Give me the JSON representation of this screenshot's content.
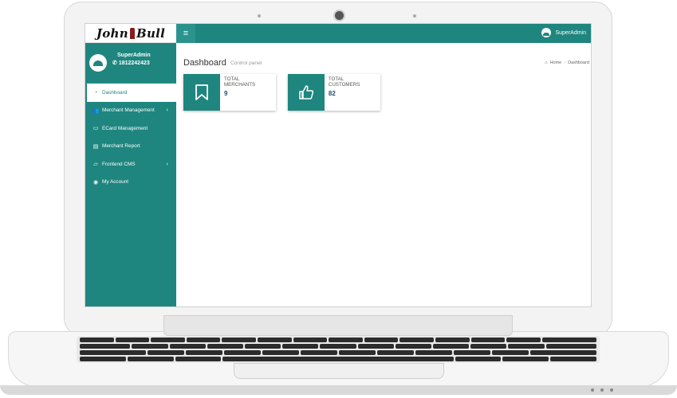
{
  "app": {
    "logo_left": "John",
    "logo_right": "Bull"
  },
  "topbar": {
    "menu_toggle": "≡",
    "user_name": "SuperAdmin"
  },
  "sidebar": {
    "profile_name": "SuperAdmin",
    "profile_phone": "1812242423",
    "items": [
      {
        "label": "Dashboard",
        "icon": "dashboard-icon",
        "active": true
      },
      {
        "label": "Merchant Management",
        "icon": "users-icon",
        "has_submenu": true
      },
      {
        "label": "ECard Management",
        "icon": "credit-card-icon"
      },
      {
        "label": "Merchant Report",
        "icon": "file-icon"
      },
      {
        "label": "Frontend CMS",
        "icon": "folder-icon",
        "has_submenu": true
      },
      {
        "label": "My Account",
        "icon": "user-circle-icon"
      }
    ]
  },
  "main": {
    "title": "Dashboard",
    "subtitle": "Control panel",
    "breadcrumb": {
      "home": "Home",
      "current": "Dashboard"
    },
    "cards": [
      {
        "label": "TOTAL MERCHANTS",
        "value": "9",
        "icon": "bookmark-icon"
      },
      {
        "label": "TOTAL CUSTOMERS",
        "value": "82",
        "icon": "thumbs-up-icon"
      }
    ]
  },
  "colors": {
    "accent": "#1f857f",
    "value_text": "#1f4f72"
  }
}
